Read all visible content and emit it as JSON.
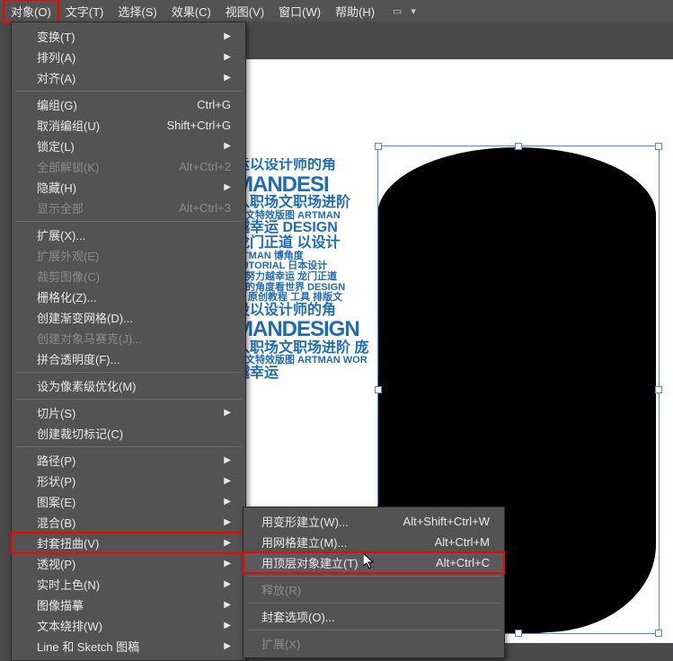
{
  "menubar": {
    "items": [
      "对象(O)",
      "文字(T)",
      "选择(S)",
      "效果(C)",
      "视图(V)",
      "窗口(W)",
      "帮助(H)"
    ],
    "highlighted_index": 0
  },
  "object_menu": {
    "groups": [
      [
        {
          "label": "变换(T)",
          "arrow": true
        },
        {
          "label": "排列(A)",
          "arrow": true
        },
        {
          "label": "对齐(A)",
          "arrow": true
        }
      ],
      [
        {
          "label": "编组(G)",
          "shortcut": "Ctrl+G"
        },
        {
          "label": "取消编组(U)",
          "shortcut": "Shift+Ctrl+G"
        },
        {
          "label": "锁定(L)",
          "arrow": true
        },
        {
          "label": "全部解锁(K)",
          "shortcut": "Alt+Ctrl+2",
          "disabled": true
        },
        {
          "label": "隐藏(H)",
          "arrow": true
        },
        {
          "label": "显示全部",
          "shortcut": "Alt+Ctrl+3",
          "disabled": true
        }
      ],
      [
        {
          "label": "扩展(X)..."
        },
        {
          "label": "扩展外观(E)",
          "disabled": true
        },
        {
          "label": "裁剪图像(C)",
          "disabled": true
        },
        {
          "label": "栅格化(Z)..."
        },
        {
          "label": "创建渐变网格(D)..."
        },
        {
          "label": "创建对象马赛克(J)...",
          "disabled": true
        },
        {
          "label": "拼合透明度(F)..."
        }
      ],
      [
        {
          "label": "设为像素级优化(M)"
        }
      ],
      [
        {
          "label": "切片(S)",
          "arrow": true
        },
        {
          "label": "创建裁切标记(C)"
        }
      ],
      [
        {
          "label": "路径(P)",
          "arrow": true
        },
        {
          "label": "形状(P)",
          "arrow": true
        },
        {
          "label": "图案(E)",
          "arrow": true
        },
        {
          "label": "混合(B)",
          "arrow": true
        },
        {
          "label": "封套扭曲(V)",
          "arrow": true,
          "highlight": true
        },
        {
          "label": "透视(P)",
          "arrow": true
        },
        {
          "label": "实时上色(N)",
          "arrow": true
        },
        {
          "label": "图像描摹",
          "arrow": true
        },
        {
          "label": "文本绕排(W)",
          "arrow": true
        },
        {
          "label": "Line 和 Sketch 图稿",
          "arrow": true
        }
      ]
    ]
  },
  "submenu": {
    "groups": [
      [
        {
          "label": "用变形建立(W)...",
          "shortcut": "Alt+Shift+Ctrl+W"
        },
        {
          "label": "用网格建立(M)...",
          "shortcut": "Alt+Ctrl+M"
        },
        {
          "label": "用顶层对象建立(T)",
          "shortcut": "Alt+Ctrl+C",
          "highlight": true
        }
      ],
      [
        {
          "label": "释放(R)",
          "disabled": true
        }
      ],
      [
        {
          "label": "封套选项(O)..."
        }
      ],
      [
        {
          "label": "扩展(X)",
          "disabled": true
        }
      ]
    ]
  },
  "canvas_text": {
    "l1": "运以设计师的角",
    "l2": "MANDESI",
    "l3": "入职场文职场进阶",
    "l4": "版文特效版图 ARTMAN",
    "l5": "越幸运 DESIGN",
    "l6": "龙门正道 以设计",
    "l7": "RTMAN 博角度",
    "l8": "TUTORIAL 日本设计",
    "l9": "越努力越幸运 龙门正道",
    "l10": "师的角度看世界 DESIGN",
    "l11": "运 原创教程 工具 排版文",
    "l12": "设以设计师的角",
    "l13": "MANDESIGN",
    "l14": "入职场文职场进阶 庞",
    "l15": "版文特效版图 ARTMAN WOR",
    "l16": "越幸运"
  }
}
